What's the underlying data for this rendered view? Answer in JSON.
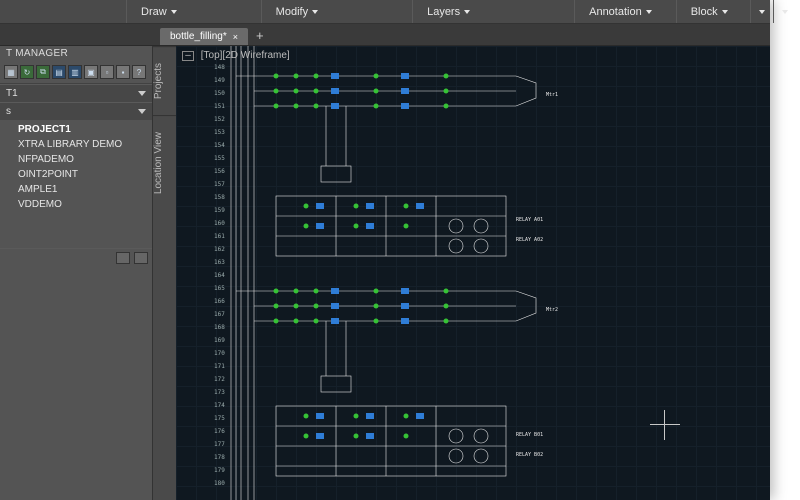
{
  "ribbon": {
    "groups": [
      "Draw",
      "Modify",
      "Layers",
      "Annotation",
      "Block"
    ]
  },
  "doctabs": {
    "active": "bottle_filling*",
    "plus_label": "+"
  },
  "panel": {
    "title": "T MANAGER",
    "section1": "T1",
    "section2": "s",
    "projects": [
      "PROJECT1",
      "XTRA LIBRARY DEMO",
      "NFPADEMO",
      "OINT2POINT",
      "AMPLE1",
      "VDDEMO"
    ]
  },
  "rails": {
    "projects": "Projects",
    "location": "Location View"
  },
  "viewport": {
    "label": "[Top][2D Wireframe]",
    "ruler_numbers": [
      "148",
      "149",
      "150",
      "151",
      "152",
      "153",
      "154",
      "155",
      "156",
      "157",
      "158",
      "159",
      "160",
      "161",
      "162",
      "163",
      "164",
      "165",
      "166",
      "167",
      "168",
      "169",
      "170",
      "171",
      "172",
      "173",
      "174",
      "175",
      "176",
      "177",
      "178",
      "179",
      "180"
    ]
  },
  "colors": {
    "canvas_bg": "#0f1820",
    "wire": "#e8e8e8",
    "terminal": "#36c236",
    "contact": "#2f7dd6"
  }
}
